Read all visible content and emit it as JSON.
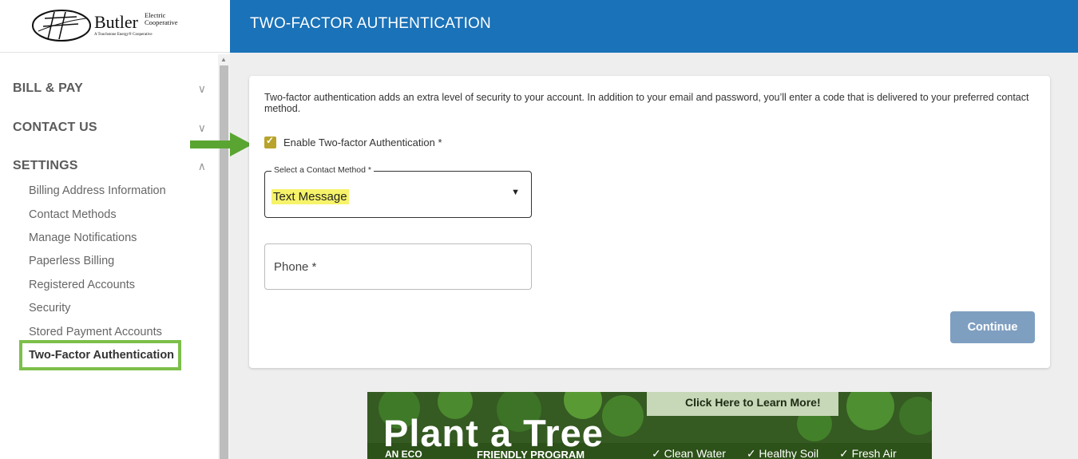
{
  "logo": {
    "name": "Butler",
    "suffix_line1": "Electric",
    "suffix_line2": "Cooperative",
    "tagline": "A Touchstone Energy® Cooperative"
  },
  "header": {
    "title": "TWO-FACTOR AUTHENTICATION"
  },
  "sidebar": {
    "sections": [
      {
        "label": "BILL & PAY",
        "chevron": "∨"
      },
      {
        "label": "CONTACT US",
        "chevron": "∨"
      },
      {
        "label": "SETTINGS",
        "chevron": "∧"
      }
    ],
    "items": [
      {
        "label": "Billing Address Information"
      },
      {
        "label": "Contact Methods"
      },
      {
        "label": "Manage Notifications"
      },
      {
        "label": "Paperless Billing"
      },
      {
        "label": "Registered Accounts"
      },
      {
        "label": "Security"
      },
      {
        "label": "Stored Payment Accounts"
      },
      {
        "label": "Two-Factor Authentication"
      }
    ]
  },
  "card": {
    "description": "Two-factor authentication adds an extra level of security to your account. In addition to your email and password, you’ll enter a code that is delivered to your preferred contact method.",
    "checkbox_label": "Enable Two-factor Authentication *",
    "checkbox_mark": "✓",
    "select_legend": "Select a Contact Method *",
    "select_value": "Text Message",
    "select_caret": "▼",
    "phone_label": "Phone *",
    "continue_label": "Continue"
  },
  "banner": {
    "cta": "Click Here to Learn More!",
    "headline": "Plant a Tree",
    "sub_left": "AN ECO",
    "sub_right": "FRIENDLY PROGRAM",
    "benefits": [
      "✓ Clean Water",
      "✓ Healthy Soil",
      "✓ Fresh Air"
    ]
  },
  "colors": {
    "header_bg": "#1a72b8",
    "active_outline": "#7cbf4a",
    "arrow": "#5aa532",
    "checkbox": "#b8a32c",
    "highlight": "#f6f36a",
    "button": "#7f9fc1"
  }
}
